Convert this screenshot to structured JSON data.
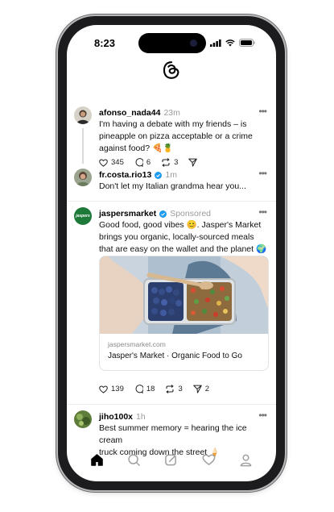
{
  "status_bar": {
    "time": "8:23"
  },
  "feed": {
    "posts": [
      {
        "username": "afonso_nada44",
        "time": "23m",
        "text": "I'm having a debate with my friends – is\npineapple on pizza acceptable or a crime\nagainst food? 🍕🍍",
        "likes": "345",
        "replies": "6",
        "reposts": "3"
      },
      {
        "username": "fr.costa.rio13",
        "time": "1m",
        "text": "Don't let my Italian grandma hear you..."
      },
      {
        "username": "jaspersmarket",
        "sponsored_label": "Sponsored",
        "text": "Good food, good vibes 😊. Jasper's Market\nbrings you organic, locally-sourced meals\nthat are easy on the wallet and the planet 🌍",
        "ad": {
          "url": "jaspersmarket.com",
          "title": "Jasper's Market · Organic Food to Go",
          "avatar_text": "jaspers"
        },
        "likes": "139",
        "replies": "18",
        "reposts": "3",
        "shares": "2"
      },
      {
        "username": "jiho100x",
        "time": "1h",
        "text": "Best summer memory = hearing the ice cream\ntruck coming down the street 🍦"
      }
    ]
  },
  "tabbar": {
    "icons": [
      "home-icon",
      "search-icon",
      "compose-icon",
      "heart-icon",
      "profile-icon"
    ]
  },
  "colors": {
    "verified": "#1d9bf0",
    "accent": "#000000"
  }
}
